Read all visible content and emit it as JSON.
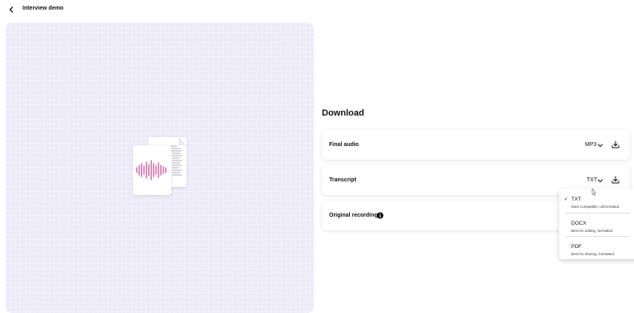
{
  "header": {
    "title": "Interview demo"
  },
  "download": {
    "heading": "Download",
    "final_audio": {
      "label": "Final audio",
      "format": "MP3"
    },
    "transcript": {
      "label": "Transcript",
      "format": "TXT"
    },
    "original_recordings": {
      "label": "Original recordings"
    }
  },
  "format_menu": {
    "options": [
      {
        "name": "TXT",
        "description": "Most compatible, unformatted",
        "selected": true
      },
      {
        "name": "DOCX",
        "description": "Best for editing, formatted",
        "selected": false
      },
      {
        "name": "PDF",
        "description": "Best for sharing, formatted",
        "selected": false
      }
    ],
    "check_mark": "✓"
  },
  "icons": {
    "back": "chevron-left-icon",
    "chevron": "chevron-down-icon",
    "download": "download-icon",
    "info": "info-icon",
    "preview": "audio-transcript-document-icon",
    "cursor": "mouse-pointer-icon"
  },
  "colors": {
    "waveform": "#c2448e",
    "preview_bg": "#eceaf8"
  }
}
